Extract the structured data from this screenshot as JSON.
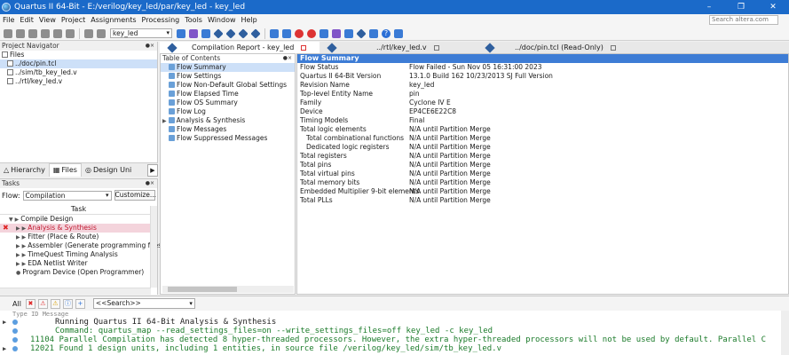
{
  "window": {
    "title": "Quartus II 64-Bit - E:/verilog/key_led/par/key_led - key_led",
    "controls": [
      "–",
      "❐",
      "✕"
    ]
  },
  "menu": {
    "items": [
      "File",
      "Edit",
      "View",
      "Project",
      "Assignments",
      "Processing",
      "Tools",
      "Window",
      "Help"
    ],
    "search_placeholder": "Search altera.com"
  },
  "toolbar": {
    "revision": "key_led"
  },
  "project_navigator": {
    "title": "Project Navigator",
    "root": "Files",
    "files": [
      "../doc/pin.tcl",
      "../sim/tb_key_led.v",
      "../rtl/key_led.v"
    ],
    "tabs": [
      "Hierarchy",
      "Files",
      "Design Uni"
    ]
  },
  "tasks": {
    "title": "Tasks",
    "flow_label": "Flow:",
    "flow_value": "Compilation",
    "customize_label": "Customize...",
    "column_header": "Task",
    "items": [
      "Compile Design",
      "Analysis & Synthesis",
      "Fitter (Place & Route)",
      "Assembler (Generate programming files",
      "TimeQuest Timing Analysis",
      "EDA Netlist Writer",
      "Program Device (Open Programmer)"
    ]
  },
  "doc_tabs": [
    {
      "label": "Compilation Report - key_led"
    },
    {
      "label": "../rtl/key_led.v"
    },
    {
      "label": "../doc/pin.tcl (Read-Only)"
    }
  ],
  "toc": {
    "title": "Table of Contents",
    "items": [
      "Flow Summary",
      "Flow Settings",
      "Flow Non-Default Global Settings",
      "Flow Elapsed Time",
      "Flow OS Summary",
      "Flow Log",
      "Analysis & Synthesis",
      "Flow Messages",
      "Flow Suppressed Messages"
    ]
  },
  "flow_summary": {
    "title": "Flow Summary",
    "rows": [
      {
        "key": "Flow Status",
        "value": "Flow Failed - Sun Nov 05 16:31:00 2023"
      },
      {
        "key": "Quartus II 64-Bit Version",
        "value": "13.1.0 Build 162 10/23/2013 SJ Full Version"
      },
      {
        "key": "Revision Name",
        "value": "key_led"
      },
      {
        "key": "Top-level Entity Name",
        "value": "pin"
      },
      {
        "key": "Family",
        "value": "Cyclone IV E"
      },
      {
        "key": "Device",
        "value": "EP4CE6E22C8"
      },
      {
        "key": "Timing Models",
        "value": "Final"
      },
      {
        "key": "Total logic elements",
        "value": "N/A until Partition Merge"
      },
      {
        "key": "Total combinational functions",
        "value": "N/A until Partition Merge"
      },
      {
        "key": "Dedicated logic registers",
        "value": "N/A until Partition Merge"
      },
      {
        "key": "Total registers",
        "value": "N/A until Partition Merge"
      },
      {
        "key": "Total pins",
        "value": "N/A until Partition Merge"
      },
      {
        "key": "Total virtual pins",
        "value": "N/A until Partition Merge"
      },
      {
        "key": "Total memory bits",
        "value": "N/A until Partition Merge"
      },
      {
        "key": "Embedded Multiplier 9-bit elements",
        "value": "N/A until Partition Merge"
      },
      {
        "key": "Total PLLs",
        "value": "N/A until Partition Merge"
      }
    ]
  },
  "messages": {
    "filter_all": "All",
    "search_placeholder": "<<Search>>",
    "columns": "Type  ID  Message",
    "lines": [
      "Running Quartus II 64-Bit Analysis & Synthesis",
      "Command: quartus_map --read_settings_files=on --write_settings_files=off key_led -c key_led",
      "11104 Parallel Compilation has detected 8 hyper-threaded processors. However, the extra hyper-threaded processors will not be used by default. Parallel C",
      "12021 Found 1 design units, including 1 entities, in source file /verilog/key_led/sim/tb_key_led.v"
    ]
  }
}
